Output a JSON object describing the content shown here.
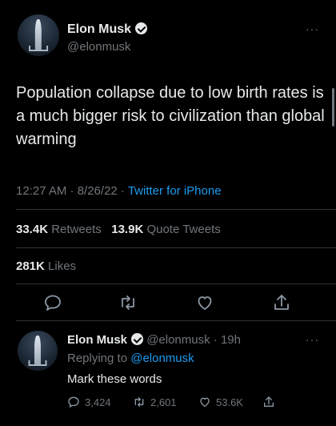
{
  "main_tweet": {
    "author_name": "Elon Musk",
    "handle": "@elonmusk",
    "more_label": "···",
    "text": "Population collapse due to low birth rates is a much bigger risk to civilization than global warming",
    "time": "12:27 AM · 8/26/22 · ",
    "source": "Twitter for iPhone",
    "retweets_count": "33.4K",
    "retweets_label": "Retweets",
    "quote_count": "13.9K",
    "quote_label": "Quote Tweets",
    "likes_count": "281K",
    "likes_label": "Likes"
  },
  "reply_tweet": {
    "author_name": "Elon Musk",
    "handle_time": "@elonmusk · 19h",
    "replying_to_label": "Replying to ",
    "replying_to_handle": "@elonmusk",
    "more_label": "···",
    "text": "Mark these words",
    "reply_count": "3,424",
    "retweet_count": "2,601",
    "like_count": "53.6K"
  },
  "colors": {
    "background": "#000000",
    "text": "#e7e9ea",
    "secondary": "#71767b",
    "link": "#1d9bf0"
  }
}
